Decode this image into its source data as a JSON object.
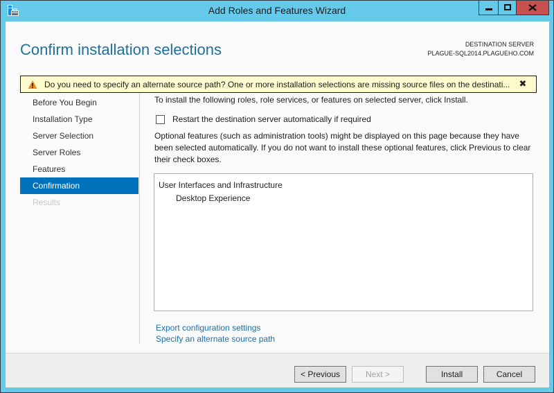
{
  "window": {
    "title": "Add Roles and Features Wizard",
    "controls": {
      "minimize": "minimize",
      "maximize": "maximize",
      "close": "close"
    }
  },
  "header": {
    "page_title": "Confirm installation selections",
    "destination_label": "DESTINATION SERVER",
    "destination_server": "PLAGUE-SQL2014.PLAGUEHO.COM"
  },
  "warning": {
    "icon": "warning-triangle-icon",
    "text": "Do you need to specify an alternate source path? One or more installation selections are missing source files on the destinati...",
    "close_glyph": "✖"
  },
  "nav": {
    "items": [
      {
        "label": "Before You Begin",
        "state": "normal"
      },
      {
        "label": "Installation Type",
        "state": "normal"
      },
      {
        "label": "Server Selection",
        "state": "normal"
      },
      {
        "label": "Server Roles",
        "state": "normal"
      },
      {
        "label": "Features",
        "state": "normal"
      },
      {
        "label": "Confirmation",
        "state": "active"
      },
      {
        "label": "Results",
        "state": "disabled"
      }
    ]
  },
  "content": {
    "intro": "To install the following roles, role services, or features on selected server, click Install.",
    "restart_checkbox": {
      "label": "Restart the destination server automatically if required",
      "checked": false
    },
    "optional_text": "Optional features (such as administration tools) might be displayed on this page because they have been selected automatically. If you do not want to install these optional features, click Previous to clear their check boxes.",
    "selections": [
      {
        "label": "User Interfaces and Infrastructure",
        "level": 0
      },
      {
        "label": "Desktop Experience",
        "level": 1
      }
    ],
    "links": {
      "export": "Export configuration settings",
      "alternate_source": "Specify an alternate source path"
    }
  },
  "footer": {
    "previous": "< Previous",
    "next": "Next >",
    "install": "Install",
    "cancel": "Cancel"
  },
  "colors": {
    "window_frame": "#65c9ea",
    "accent": "#0072bc",
    "title_text": "#1f6f9d",
    "link": "#1b6fa8",
    "warning_bg": "#fdfbce",
    "close_button": "#c75050"
  }
}
